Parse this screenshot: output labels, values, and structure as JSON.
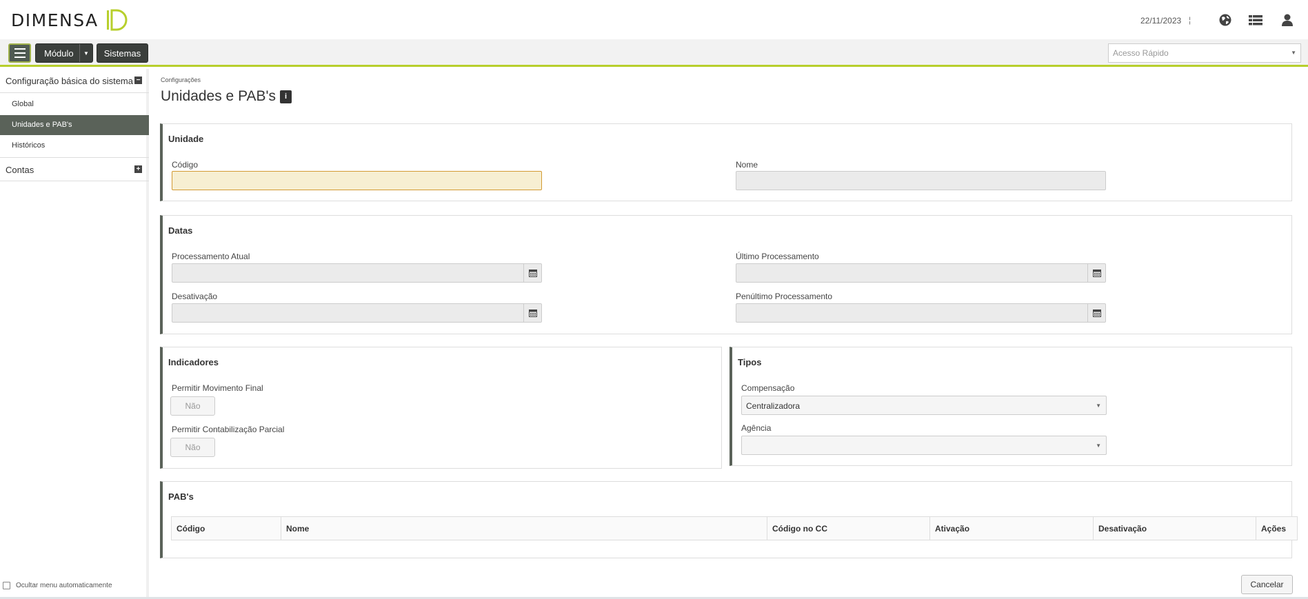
{
  "header": {
    "logo_text": "DIMENSA",
    "date": "22/11/2023",
    "separator": "¦",
    "icons": [
      "globe-icon",
      "list-icon",
      "user-icon"
    ]
  },
  "toolbar": {
    "menu_icon": "hamburger-icon",
    "modulo_label": "Módulo",
    "sistemas_label": "Sistemas",
    "quick_access_placeholder": "Acesso Rápido"
  },
  "sidebar": {
    "sections": [
      {
        "label": "Configuração básica do sistema",
        "toggle": "−"
      },
      {
        "label": "Contas",
        "toggle": "+"
      }
    ],
    "items": [
      {
        "label": "Global"
      },
      {
        "label": "Unidades e PAB's"
      },
      {
        "label": "Históricos"
      }
    ],
    "auto_hide_label": "Ocultar menu automaticamente"
  },
  "main": {
    "breadcrumb": "Configurações",
    "title": "Unidades e PAB's",
    "info_icon": "i",
    "unidade": {
      "title": "Unidade",
      "codigo_label": "Código",
      "codigo_value": "",
      "nome_label": "Nome",
      "nome_value": ""
    },
    "datas": {
      "title": "Datas",
      "processamento_atual_label": "Processamento Atual",
      "ultimo_processamento_label": "Último Processamento",
      "desativacao_label": "Desativação",
      "penultimo_processamento_label": "Penúltimo Processamento"
    },
    "indicadores": {
      "title": "Indicadores",
      "movimento_final_label": "Permitir Movimento Final",
      "movimento_final_value": "Não",
      "contabilizacao_parcial_label": "Permitir Contabilização Parcial",
      "contabilizacao_parcial_value": "Não"
    },
    "tipos": {
      "title": "Tipos",
      "compensacao_label": "Compensação",
      "compensacao_value": "Centralizadora",
      "agencia_label": "Agência",
      "agencia_value": ""
    },
    "pabs": {
      "title": "PAB's",
      "columns": [
        "Código",
        "Nome",
        "Código no CC",
        "Ativação",
        "Desativação",
        "Ações"
      ]
    },
    "cancel_label": "Cancelar"
  },
  "colors": {
    "accent": "#b7cf2c",
    "dark_button": "#3b3f3c",
    "active_sidebar": "#5a6259",
    "focus_input_bg": "#f7efd2",
    "focus_input_border": "#d39a33"
  }
}
